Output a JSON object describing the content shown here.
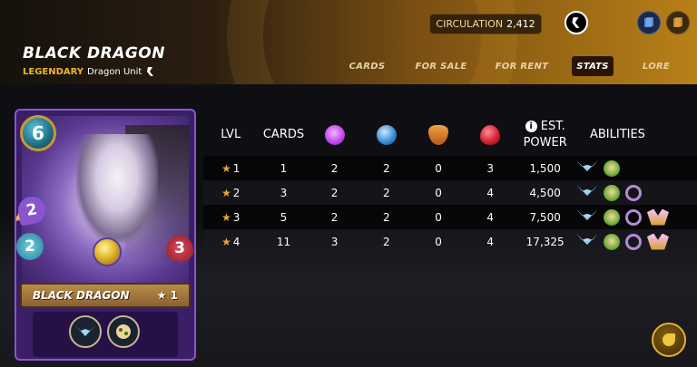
{
  "header": {
    "title": "BLACK DRAGON",
    "rarity": "LEGENDARY",
    "unit_type": "Dragon Unit",
    "circulation_label": "CIRCULATION",
    "circulation_value": "2,412"
  },
  "tabs": [
    {
      "label": "CARDS",
      "active": false
    },
    {
      "label": "FOR SALE",
      "active": false
    },
    {
      "label": "FOR RENT",
      "active": false
    },
    {
      "label": "STATS",
      "active": true
    },
    {
      "label": "LORE",
      "active": false
    }
  ],
  "card": {
    "name": "BLACK DRAGON",
    "level_label": "★ 1",
    "mana": "6",
    "magic": "2",
    "speed": "2",
    "health": "3",
    "abilities": [
      "flying-icon",
      "afflict-icon"
    ]
  },
  "table": {
    "headers": {
      "lvl": "LVL",
      "cards": "CARDS",
      "magic_icon": "magic-attack-icon",
      "ranged_icon": "speed-icon",
      "armor_icon": "armor-icon",
      "health_icon": "health-icon",
      "power_line1": "EST.",
      "power_line2": "POWER",
      "abilities": "ABILITIES"
    },
    "rows": [
      {
        "lvl": "1",
        "cards": "1",
        "magic": "2",
        "speed": "2",
        "armor": "0",
        "health": "3",
        "power": "1,500",
        "abilities": [
          "flying",
          "afflict"
        ]
      },
      {
        "lvl": "2",
        "cards": "3",
        "magic": "2",
        "speed": "2",
        "armor": "0",
        "health": "4",
        "power": "4,500",
        "abilities": [
          "flying",
          "afflict",
          "void"
        ]
      },
      {
        "lvl": "3",
        "cards": "5",
        "magic": "2",
        "speed": "2",
        "armor": "0",
        "health": "4",
        "power": "7,500",
        "abilities": [
          "flying",
          "afflict",
          "void",
          "reach"
        ]
      },
      {
        "lvl": "4",
        "cards": "11",
        "magic": "3",
        "speed": "2",
        "armor": "0",
        "health": "4",
        "power": "17,325",
        "abilities": [
          "flying",
          "afflict",
          "void",
          "reach"
        ]
      }
    ]
  },
  "colors": {
    "accent": "#f0b52b",
    "card_frame": "#8a55cf",
    "active_tab": "#2a1408"
  }
}
